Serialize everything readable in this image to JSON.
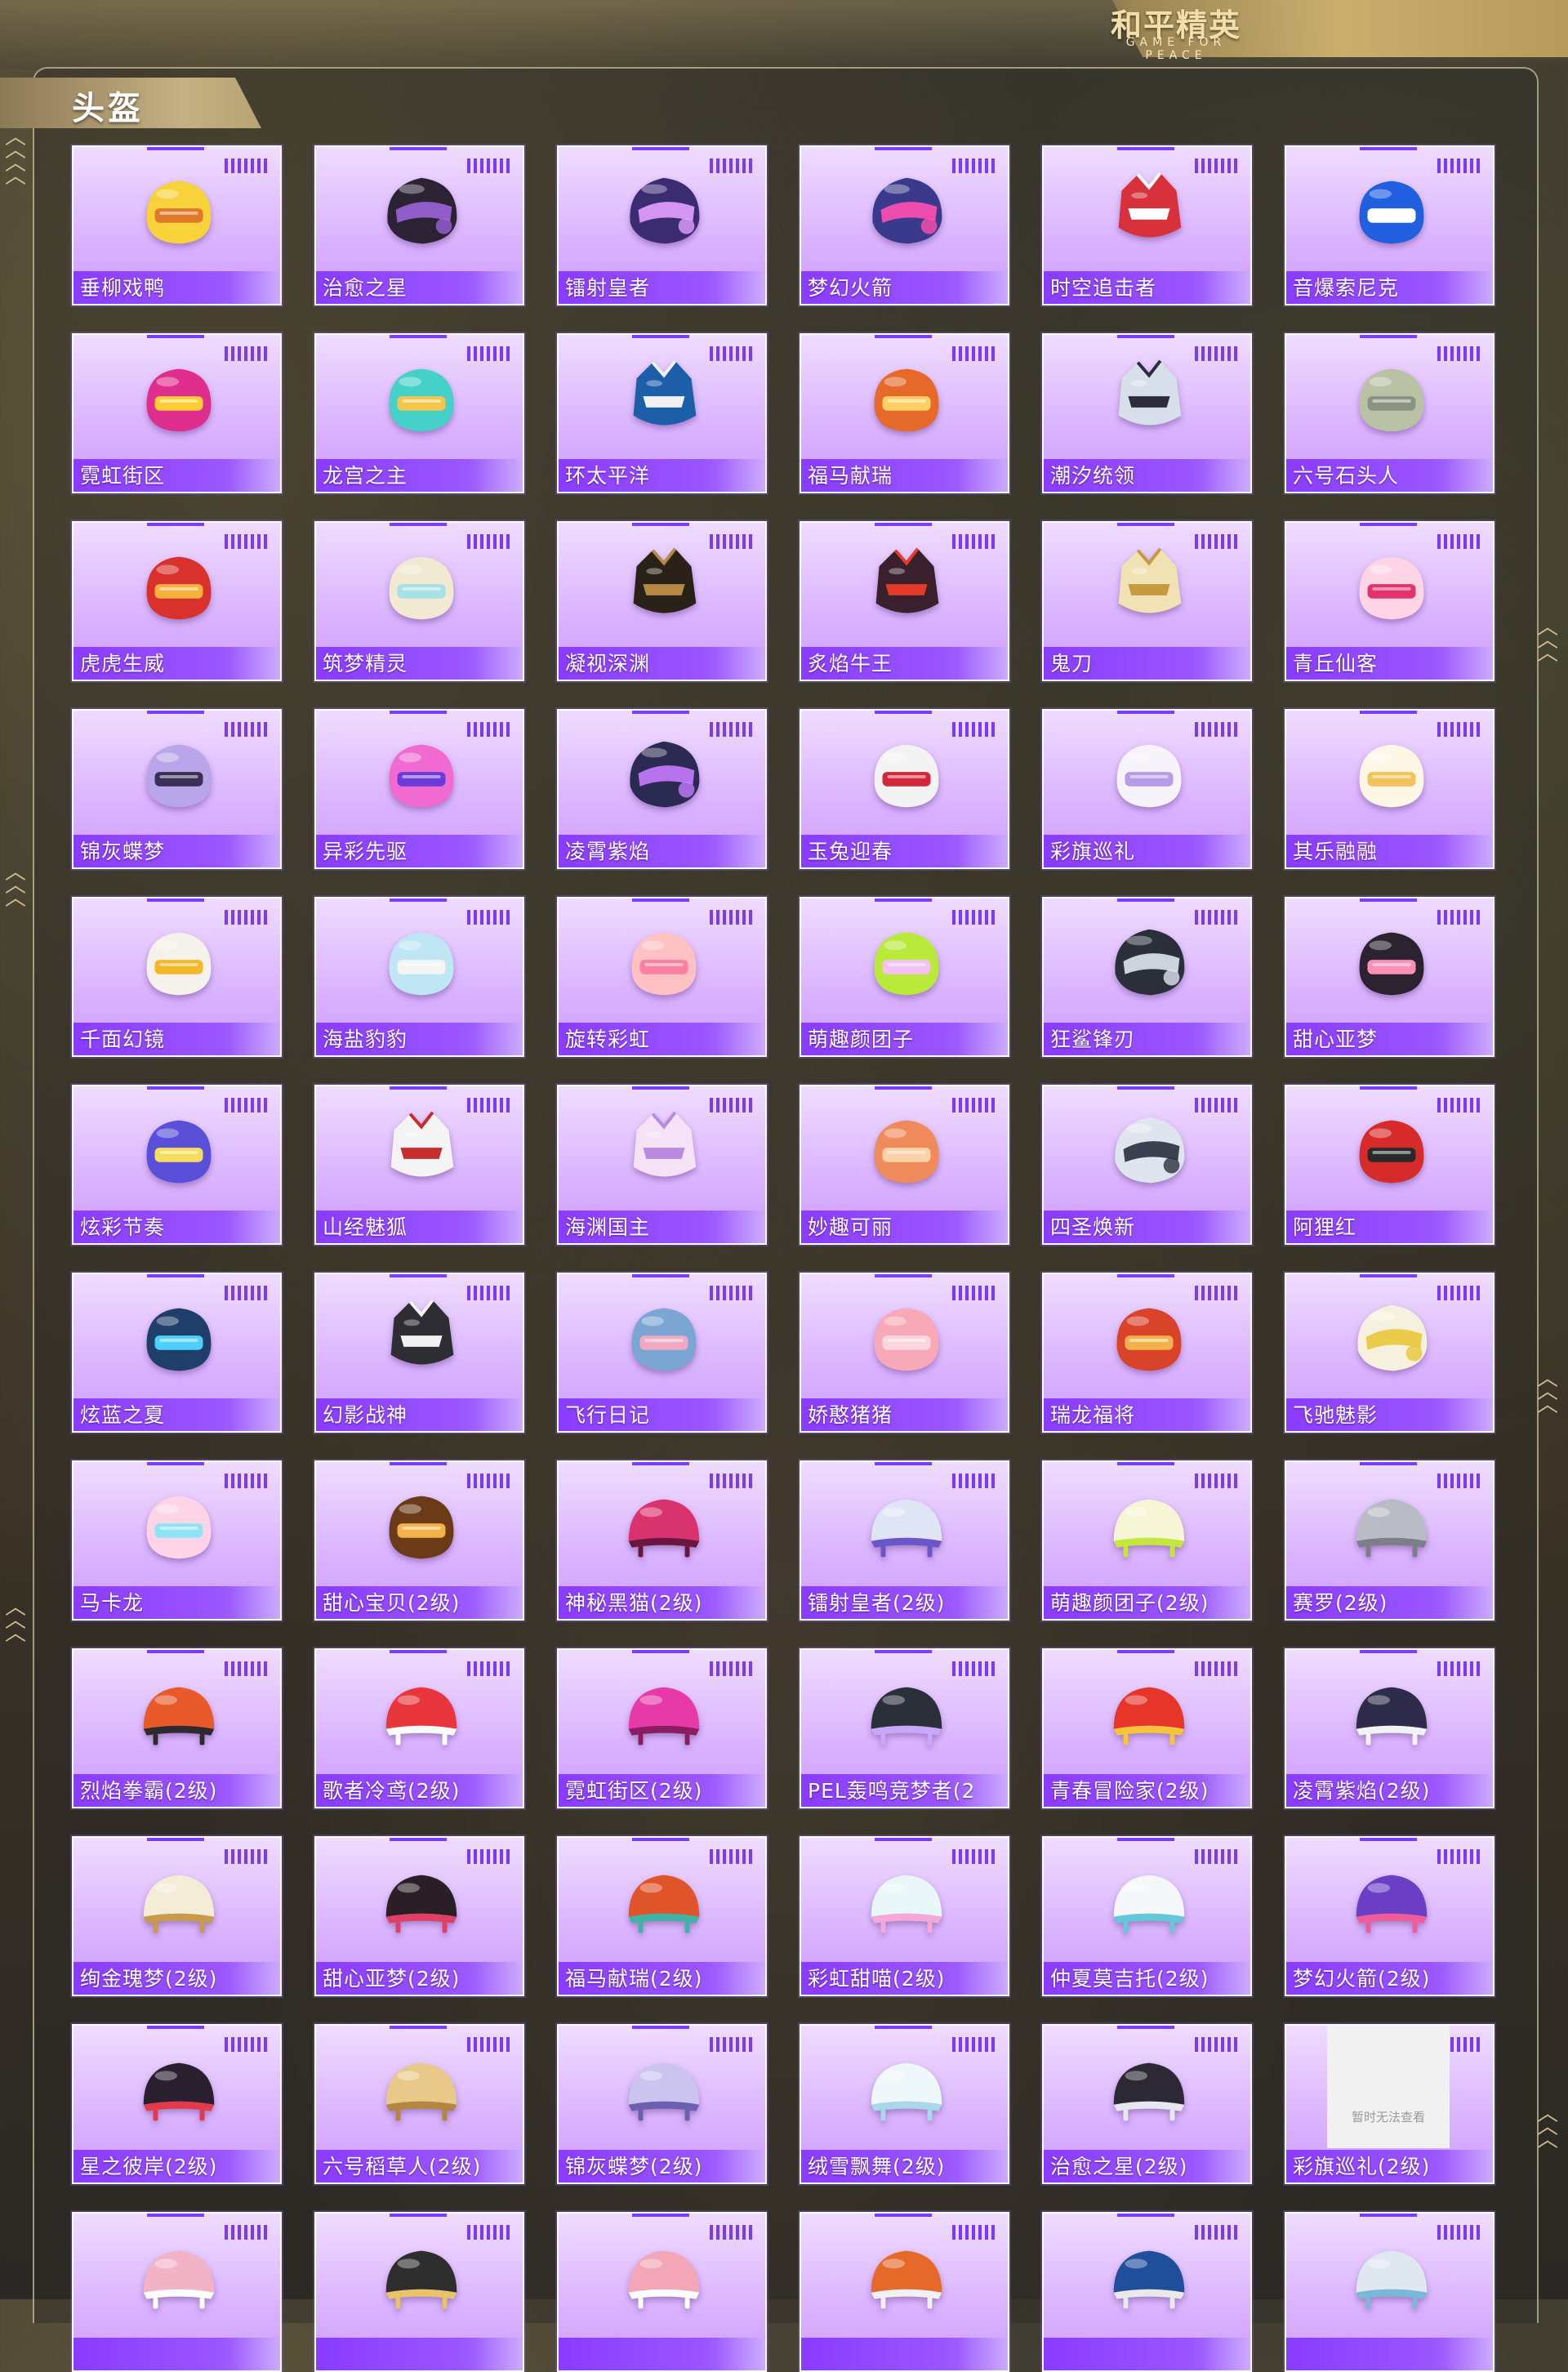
{
  "header": {
    "logo_text": "和平精英",
    "logo_subtitle": "GAME FOR PEACE"
  },
  "section": {
    "title": "头盔"
  },
  "placeholder_text": "暂时无法查看",
  "helmets": [
    {
      "name": "垂柳戏鸭",
      "shape": "round",
      "c1": "#f7d23a",
      "c2": "#e07a2a"
    },
    {
      "name": "治愈之星",
      "shape": "moto",
      "c1": "#2b2234",
      "c2": "#9a63d8"
    },
    {
      "name": "镭射皇者",
      "shape": "moto",
      "c1": "#3b2c72",
      "c2": "#e6a0ff"
    },
    {
      "name": "梦幻火箭",
      "shape": "moto",
      "c1": "#3a3a8c",
      "c2": "#ff4fb0"
    },
    {
      "name": "时空追击者",
      "shape": "mech",
      "c1": "#d8313c",
      "c2": "#ffffff"
    },
    {
      "name": "音爆索尼克",
      "shape": "round",
      "c1": "#1f5fe0",
      "c2": "#ffffff"
    },
    {
      "name": "霓虹街区",
      "shape": "round",
      "c1": "#e02e8e",
      "c2": "#ffcc33"
    },
    {
      "name": "龙宫之主",
      "shape": "round",
      "c1": "#45d1c7",
      "c2": "#f5c64c"
    },
    {
      "name": "环太平洋",
      "shape": "mech",
      "c1": "#1d5ea9",
      "c2": "#f0f0f0"
    },
    {
      "name": "福马献瑞",
      "shape": "round",
      "c1": "#e56a2a",
      "c2": "#ffcf63"
    },
    {
      "name": "潮汐统领",
      "shape": "mech",
      "c1": "#d7e0ea",
      "c2": "#2c2c3a"
    },
    {
      "name": "六号石头人",
      "shape": "round",
      "c1": "#b9c2a5",
      "c2": "#8a9482"
    },
    {
      "name": "虎虎生威",
      "shape": "round",
      "c1": "#d9312c",
      "c2": "#f6b03c"
    },
    {
      "name": "筑梦精灵",
      "shape": "round",
      "c1": "#f2e9d2",
      "c2": "#a6e1e4"
    },
    {
      "name": "凝视深渊",
      "shape": "mech",
      "c1": "#2a2218",
      "c2": "#b48a44"
    },
    {
      "name": "炙焰牛王",
      "shape": "mech",
      "c1": "#3a1f2c",
      "c2": "#e33a2a"
    },
    {
      "name": "鬼刀",
      "shape": "mech",
      "c1": "#f1e2b3",
      "c2": "#c69a3e"
    },
    {
      "name": "青丘仙客",
      "shape": "round",
      "c1": "#ffd5e6",
      "c2": "#e2336d"
    },
    {
      "name": "锦灰蝶梦",
      "shape": "round",
      "c1": "#b9a6ea",
      "c2": "#3a2f56"
    },
    {
      "name": "异彩先驱",
      "shape": "round",
      "c1": "#f06ad1",
      "c2": "#6c3ad8"
    },
    {
      "name": "凌霄紫焰",
      "shape": "moto",
      "c1": "#2a2a52",
      "c2": "#c77bff"
    },
    {
      "name": "玉兔迎春",
      "shape": "round",
      "c1": "#f3f3f3",
      "c2": "#d3283c"
    },
    {
      "name": "彩旗巡礼",
      "shape": "round",
      "c1": "#f7f3fb",
      "c2": "#b79ce8"
    },
    {
      "name": "其乐融融",
      "shape": "round",
      "c1": "#fff7e6",
      "c2": "#f1c35a"
    },
    {
      "name": "千面幻镜",
      "shape": "round",
      "c1": "#f4f2ea",
      "c2": "#f3b82a"
    },
    {
      "name": "海盐豹豹",
      "shape": "round",
      "c1": "#bfe6f4",
      "c2": "#f4f4f4"
    },
    {
      "name": "旋转彩虹",
      "shape": "round",
      "c1": "#ffc1c4",
      "c2": "#ff7fa0"
    },
    {
      "name": "萌趣颜团子",
      "shape": "round",
      "c1": "#b9e93a",
      "c2": "#f3c1f2"
    },
    {
      "name": "狂鲨锋刃",
      "shape": "moto",
      "c1": "#2a2f3a",
      "c2": "#dfe6ee"
    },
    {
      "name": "甜心亚梦",
      "shape": "round",
      "c1": "#2b2430",
      "c2": "#ff8fb7"
    },
    {
      "name": "炫彩节奏",
      "shape": "round",
      "c1": "#5a4fd8",
      "c2": "#f5de5b"
    },
    {
      "name": "山经魅狐",
      "shape": "mech",
      "c1": "#f4f4f4",
      "c2": "#c72d2d"
    },
    {
      "name": "海渊国主",
      "shape": "mech",
      "c1": "#f5e2f6",
      "c2": "#b98ae0"
    },
    {
      "name": "妙趣可丽",
      "shape": "round",
      "c1": "#ef8a5a",
      "c2": "#ffd1a6"
    },
    {
      "name": "四圣焕新",
      "shape": "moto",
      "c1": "#dfe5ee",
      "c2": "#2a2f3d"
    },
    {
      "name": "阿狸红",
      "shape": "round",
      "c1": "#d72a2a",
      "c2": "#2a2a2a"
    },
    {
      "name": "炫蓝之夏",
      "shape": "round",
      "c1": "#1f3e6a",
      "c2": "#4dd0ff"
    },
    {
      "name": "幻影战神",
      "shape": "mech",
      "c1": "#2d2d33",
      "c2": "#f1f1f1"
    },
    {
      "name": "飞行日记",
      "shape": "round",
      "c1": "#7ba6d4",
      "c2": "#f0a8c3"
    },
    {
      "name": "娇憨猪猪",
      "shape": "round",
      "c1": "#f7a9b8",
      "c2": "#fbd5dd"
    },
    {
      "name": "瑞龙福将",
      "shape": "round",
      "c1": "#d9432a",
      "c2": "#f2b24a"
    },
    {
      "name": "飞驰魅影",
      "shape": "moto",
      "c1": "#f6f1df",
      "c2": "#e9c73a"
    },
    {
      "name": "马卡龙",
      "shape": "round",
      "c1": "#ffd4e6",
      "c2": "#8fe3f2"
    },
    {
      "name": "甜心宝贝(2级)",
      "shape": "round",
      "c1": "#6b3b17",
      "c2": "#f3b24a"
    },
    {
      "name": "神秘黑猫(2级)",
      "shape": "cap",
      "c1": "#d9336d",
      "c2": "#6a1640"
    },
    {
      "name": "镭射皇者(2级)",
      "shape": "cap",
      "c1": "#dfe5f5",
      "c2": "#6a55c9"
    },
    {
      "name": "萌趣颜团子(2级)",
      "shape": "cap",
      "c1": "#f6f6d6",
      "c2": "#c3e83b"
    },
    {
      "name": "赛罗(2级)",
      "shape": "cap",
      "c1": "#b9bcc4",
      "c2": "#7a7f89"
    },
    {
      "name": "烈焰拳霸(2级)",
      "shape": "cap",
      "c1": "#e85a2a",
      "c2": "#2f2a2f"
    },
    {
      "name": "歌者冷鸢(2级)",
      "shape": "cap",
      "c1": "#e9363c",
      "c2": "#ffffff"
    },
    {
      "name": "霓虹街区(2级)",
      "shape": "cap",
      "c1": "#e73aa8",
      "c2": "#8b1c5f"
    },
    {
      "name": "PEL轰鸣竞梦者(2",
      "shape": "cap",
      "c1": "#2a2f3a",
      "c2": "#c9a6ff"
    },
    {
      "name": "青春冒险家(2级)",
      "shape": "cap",
      "c1": "#e8352a",
      "c2": "#f6c43a"
    },
    {
      "name": "凌霄紫焰(2级)",
      "shape": "cap",
      "c1": "#2f2b4a",
      "c2": "#f2f2f2"
    },
    {
      "name": "绚金瑰梦(2级)",
      "shape": "cap",
      "c1": "#f4ecd6",
      "c2": "#c79b4a"
    },
    {
      "name": "甜心亚梦(2级)",
      "shape": "cap",
      "c1": "#2a1f25",
      "c2": "#e04066"
    },
    {
      "name": "福马献瑞(2级)",
      "shape": "cap",
      "c1": "#e0542a",
      "c2": "#3fb4a5"
    },
    {
      "name": "彩虹甜喵(2级)",
      "shape": "cap",
      "c1": "#e9f7f8",
      "c2": "#f4a8d8"
    },
    {
      "name": "仲夏莫吉托(2级)",
      "shape": "cap",
      "c1": "#f4f8fa",
      "c2": "#64c8d8"
    },
    {
      "name": "梦幻火箭(2级)",
      "shape": "cap",
      "c1": "#6b3ec6",
      "c2": "#f15b9a"
    },
    {
      "name": "星之彼岸(2级)",
      "shape": "cap",
      "c1": "#2a1f2e",
      "c2": "#e23a4a"
    },
    {
      "name": "六号稻草人(2级)",
      "shape": "cap",
      "c1": "#e8c98a",
      "c2": "#b3873f"
    },
    {
      "name": "锦灰蝶梦(2级)",
      "shape": "cap",
      "c1": "#cbc4ee",
      "c2": "#6a5fb0"
    },
    {
      "name": "绒雪飘舞(2级)",
      "shape": "cap",
      "c1": "#eef8fb",
      "c2": "#a8d8ea"
    },
    {
      "name": "治愈之星(2级)",
      "shape": "cap",
      "c1": "#2c2934",
      "c2": "#e7e7ef"
    },
    {
      "name": "彩旗巡礼(2级)",
      "shape": "placeholder",
      "c1": "#f1f1f1",
      "c2": "#dcdcdc"
    },
    {
      "name": "",
      "shape": "cap",
      "c1": "#f2b3c6",
      "c2": "#ffffff"
    },
    {
      "name": "",
      "shape": "cap",
      "c1": "#2e2e2e",
      "c2": "#e7c36a"
    },
    {
      "name": "",
      "shape": "cap",
      "c1": "#f3a6b8",
      "c2": "#ffffff"
    },
    {
      "name": "",
      "shape": "cap",
      "c1": "#e56a2a",
      "c2": "#f1f1f1"
    },
    {
      "name": "",
      "shape": "cap",
      "c1": "#1f4f9a",
      "c2": "#e9e9e9"
    },
    {
      "name": "",
      "shape": "cap",
      "c1": "#dfe7f1",
      "c2": "#7bb7d9"
    }
  ]
}
